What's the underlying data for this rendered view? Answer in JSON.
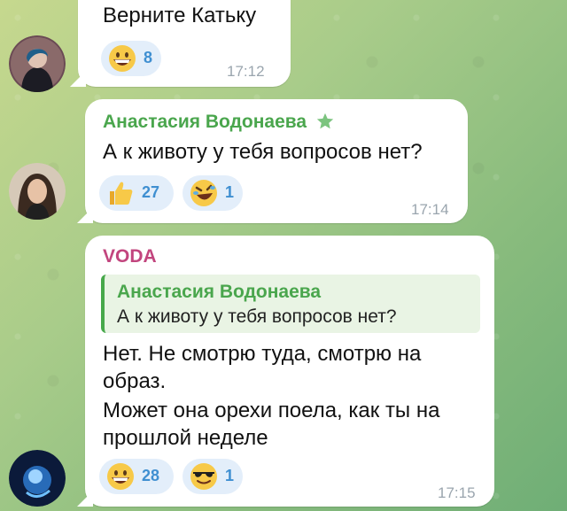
{
  "messages": [
    {
      "text": "Верните Катьку",
      "reactions": [
        {
          "emoji": "grinning-face",
          "count": "8"
        }
      ],
      "time": "17:12"
    },
    {
      "sender": "Анастасия Водонаева",
      "sender_color": "#4aa64d",
      "text": "А к животу у тебя вопросов нет?",
      "reactions": [
        {
          "emoji": "thumbs-up",
          "count": "27"
        },
        {
          "emoji": "rolling-on-floor-laughing",
          "count": "1"
        }
      ],
      "time": "17:14"
    },
    {
      "sender": "VODA",
      "sender_color": "#c2457e",
      "reply": {
        "sender": "Анастасия Водонаева",
        "text": "А к животу у тебя вопросов нет?"
      },
      "lines": [
        "Нет. Не смотрю туда, смотрю на",
        "образ.",
        "Может она орехи поела, как ты на",
        "прошлой неделе"
      ],
      "reactions": [
        {
          "emoji": "grinning-face",
          "count": "28"
        },
        {
          "emoji": "smiling-face-with-sunglasses",
          "count": "1"
        }
      ],
      "time": "17:15"
    }
  ],
  "colors": {
    "reaction_bg": "#e3eefa",
    "reaction_text": "#3f8fd1",
    "time": "#9aa5ae",
    "quote_bg": "#e9f4e4",
    "quote_bar": "#47a84b"
  }
}
